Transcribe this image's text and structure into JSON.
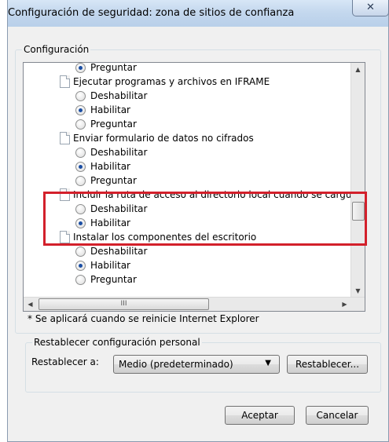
{
  "window": {
    "title": "Configuración de seguridad: zona de sitios de confianza",
    "close_glyph": "✕"
  },
  "settings_group": {
    "label": "Configuración",
    "items": [
      {
        "type": "radio",
        "label": "Preguntar",
        "selected": true
      },
      {
        "type": "setting",
        "label": "Ejecutar programas y archivos en IFRAME"
      },
      {
        "type": "radio",
        "label": "Deshabilitar",
        "selected": false
      },
      {
        "type": "radio",
        "label": "Habilitar",
        "selected": true
      },
      {
        "type": "radio",
        "label": "Preguntar",
        "selected": false
      },
      {
        "type": "setting",
        "label": "Enviar formulario de datos no cifrados"
      },
      {
        "type": "radio",
        "label": "Deshabilitar",
        "selected": false
      },
      {
        "type": "radio",
        "label": "Habilitar",
        "selected": true
      },
      {
        "type": "radio",
        "label": "Preguntar",
        "selected": false
      },
      {
        "type": "setting",
        "label": "Incluir la ruta de acceso al directorio local cuando se carguen"
      },
      {
        "type": "radio",
        "label": "Deshabilitar",
        "selected": false
      },
      {
        "type": "radio",
        "label": "Habilitar",
        "selected": true
      },
      {
        "type": "setting",
        "label": "Instalar los componentes del escritorio"
      },
      {
        "type": "radio",
        "label": "Deshabilitar",
        "selected": false
      },
      {
        "type": "radio",
        "label": "Habilitar",
        "selected": true
      },
      {
        "type": "radio",
        "label": "Preguntar",
        "selected": false
      }
    ],
    "note": "* Se aplicará cuando se reinicie Internet Explorer",
    "hscroll_grip": "III"
  },
  "reset_group": {
    "label": "Restablecer configuración personal",
    "reset_to_label": "Restablecer a:",
    "level_value": "Medio (predeterminado)",
    "reset_button": "Restablecer..."
  },
  "footer": {
    "ok_button": "Aceptar",
    "cancel_button": "Cancelar"
  },
  "colors": {
    "highlight_border": "#d3202b",
    "radio_dot": "#1b4ea3",
    "window_frame": "#b9d1ea"
  }
}
